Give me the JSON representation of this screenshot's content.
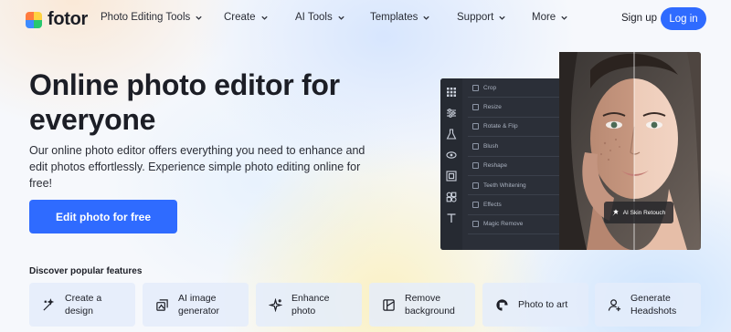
{
  "nav": {
    "logo_text": "fotor",
    "menu": [
      {
        "label": "Photo Editing Tools"
      },
      {
        "label": "Create"
      },
      {
        "label": "AI Tools"
      },
      {
        "label": "Templates"
      },
      {
        "label": "Support"
      },
      {
        "label": "More"
      }
    ],
    "signup_label": "Sign up",
    "login_label": "Log in"
  },
  "hero": {
    "title": "Online photo editor for everyone",
    "description": "Our online photo editor offers everything you need to enhance and edit photos effortlessly. Experience simple photo editing online for free!",
    "cta_label": "Edit photo for free"
  },
  "editor_preview": {
    "rail_icons": [
      "grid-icon",
      "sliders-icon",
      "beaker-icon",
      "eye-icon",
      "frame-icon",
      "shapes-icon",
      "text-icon"
    ],
    "panel_items": [
      {
        "label": "Crop"
      },
      {
        "label": "Resize"
      },
      {
        "label": "Rotate & Flip"
      },
      {
        "label": "Blush"
      },
      {
        "label": "Reshape"
      },
      {
        "label": "Teeth Whitening"
      },
      {
        "label": "Effects"
      },
      {
        "label": "Magic Remove"
      }
    ],
    "badge_label": "AI Skin Retouch"
  },
  "features": {
    "heading": "Discover popular features",
    "items": [
      {
        "label": "Create a design",
        "icon": "wand-icon"
      },
      {
        "label": "AI image generator",
        "icon": "image-stack-icon"
      },
      {
        "label": "Enhance photo",
        "icon": "sparkle-icon"
      },
      {
        "label": "Remove background",
        "icon": "remove-bg-icon"
      },
      {
        "label": "Photo to art",
        "icon": "art-icon"
      },
      {
        "label": "Generate Headshots",
        "icon": "user-plus-icon"
      }
    ]
  },
  "colors": {
    "accent": "#2f6bff",
    "editor_bg": "#2b2f38",
    "text": "#1c1e26"
  }
}
